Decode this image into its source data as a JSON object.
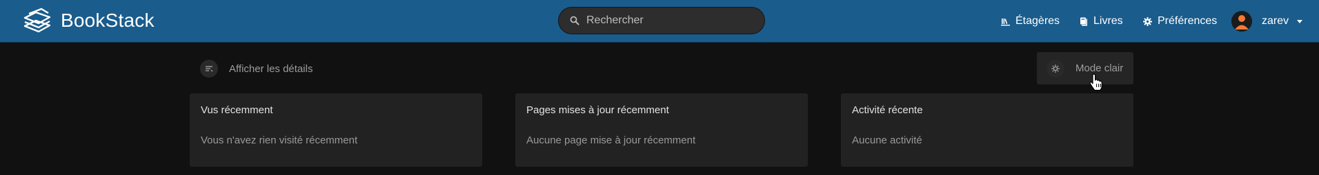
{
  "header": {
    "brand": "BookStack",
    "search_placeholder": "Rechercher",
    "nav": {
      "shelves": "Étagères",
      "books": "Livres",
      "preferences": "Préférences"
    },
    "user": {
      "name": "zarev"
    }
  },
  "actions": {
    "show_details": "Afficher les détails",
    "light_mode": "Mode clair"
  },
  "cards": [
    {
      "title": "Vus récemment",
      "empty": "Vous n'avez rien visité récemment"
    },
    {
      "title": "Pages mises à jour récemment",
      "empty": "Aucune page mise à jour récemment"
    },
    {
      "title": "Activité récente",
      "empty": "Aucune activité"
    }
  ],
  "colors": {
    "header": "#1a5c8c",
    "background": "#111111",
    "card": "#222222"
  },
  "icons": [
    "bookstack-logo-icon",
    "search-icon",
    "shelves-icon",
    "books-icon",
    "gear-icon",
    "avatar-icon",
    "caret-down-icon",
    "list-details-icon",
    "sun-icon",
    "hand-cursor-icon"
  ]
}
